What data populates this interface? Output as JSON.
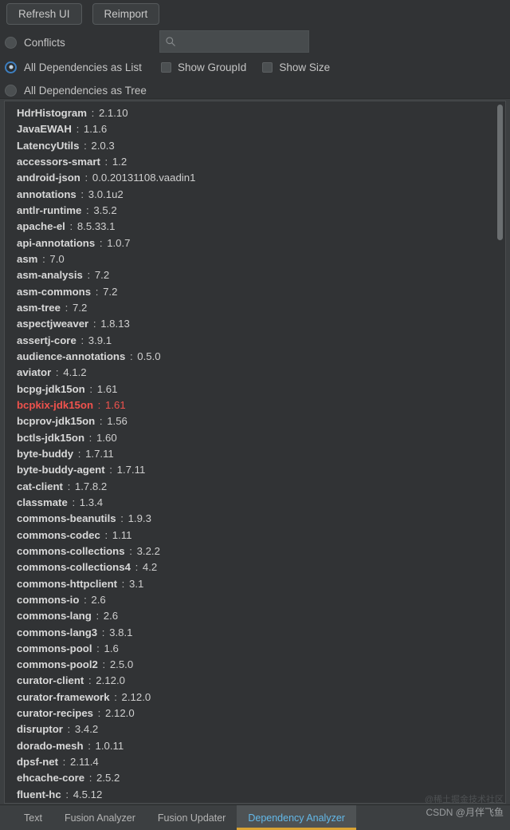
{
  "accent": {
    "gold": "#d9a334",
    "blue": "#3d7fc1",
    "tab_active_text": "#63b8e8",
    "conflict_red": "#f0524d",
    "panel_bg": "#313335",
    "window_bg": "#3c3f41"
  },
  "toolbar": {
    "buttons": [
      {
        "label": "Refresh UI",
        "icon": "refresh-icon"
      },
      {
        "label": "Reimport",
        "icon": "reimport-icon"
      }
    ],
    "view_mode_options": [
      {
        "label": "Conflicts",
        "selected": false
      },
      {
        "label": "All Dependencies as List",
        "selected": true
      },
      {
        "label": "All Dependencies as Tree",
        "selected": false
      }
    ],
    "search": {
      "icon": "search-icon",
      "value": "",
      "placeholder": ""
    },
    "checkboxes": [
      {
        "label": "Show GroupId",
        "checked": false
      },
      {
        "label": "Show Size",
        "checked": false
      }
    ]
  },
  "dependency_list": {
    "separator": ":",
    "items": [
      {
        "name": "HdrHistogram",
        "version": "2.1.10",
        "conflict": false
      },
      {
        "name": "JavaEWAH",
        "version": "1.1.6",
        "conflict": false
      },
      {
        "name": "LatencyUtils",
        "version": "2.0.3",
        "conflict": false
      },
      {
        "name": "accessors-smart",
        "version": "1.2",
        "conflict": false
      },
      {
        "name": "android-json",
        "version": "0.0.20131108.vaadin1",
        "conflict": false
      },
      {
        "name": "annotations",
        "version": "3.0.1u2",
        "conflict": false
      },
      {
        "name": "antlr-runtime",
        "version": "3.5.2",
        "conflict": false
      },
      {
        "name": "apache-el",
        "version": "8.5.33.1",
        "conflict": false
      },
      {
        "name": "api-annotations",
        "version": "1.0.7",
        "conflict": false
      },
      {
        "name": "asm",
        "version": "7.0",
        "conflict": false
      },
      {
        "name": "asm-analysis",
        "version": "7.2",
        "conflict": false
      },
      {
        "name": "asm-commons",
        "version": "7.2",
        "conflict": false
      },
      {
        "name": "asm-tree",
        "version": "7.2",
        "conflict": false
      },
      {
        "name": "aspectjweaver",
        "version": "1.8.13",
        "conflict": false
      },
      {
        "name": "assertj-core",
        "version": "3.9.1",
        "conflict": false
      },
      {
        "name": "audience-annotations",
        "version": "0.5.0",
        "conflict": false
      },
      {
        "name": "aviator",
        "version": "4.1.2",
        "conflict": false
      },
      {
        "name": "bcpg-jdk15on",
        "version": "1.61",
        "conflict": false
      },
      {
        "name": "bcpkix-jdk15on",
        "version": "1.61",
        "conflict": true
      },
      {
        "name": "bcprov-jdk15on",
        "version": "1.56",
        "conflict": false
      },
      {
        "name": "bctls-jdk15on",
        "version": "1.60",
        "conflict": false
      },
      {
        "name": "byte-buddy",
        "version": "1.7.11",
        "conflict": false
      },
      {
        "name": "byte-buddy-agent",
        "version": "1.7.11",
        "conflict": false
      },
      {
        "name": "cat-client",
        "version": "1.7.8.2",
        "conflict": false
      },
      {
        "name": "classmate",
        "version": "1.3.4",
        "conflict": false
      },
      {
        "name": "commons-beanutils",
        "version": "1.9.3",
        "conflict": false
      },
      {
        "name": "commons-codec",
        "version": "1.11",
        "conflict": false
      },
      {
        "name": "commons-collections",
        "version": "3.2.2",
        "conflict": false
      },
      {
        "name": "commons-collections4",
        "version": "4.2",
        "conflict": false
      },
      {
        "name": "commons-httpclient",
        "version": "3.1",
        "conflict": false
      },
      {
        "name": "commons-io",
        "version": "2.6",
        "conflict": false
      },
      {
        "name": "commons-lang",
        "version": "2.6",
        "conflict": false
      },
      {
        "name": "commons-lang3",
        "version": "3.8.1",
        "conflict": false
      },
      {
        "name": "commons-pool",
        "version": "1.6",
        "conflict": false
      },
      {
        "name": "commons-pool2",
        "version": "2.5.0",
        "conflict": false
      },
      {
        "name": "curator-client",
        "version": "2.12.0",
        "conflict": false
      },
      {
        "name": "curator-framework",
        "version": "2.12.0",
        "conflict": false
      },
      {
        "name": "curator-recipes",
        "version": "2.12.0",
        "conflict": false
      },
      {
        "name": "disruptor",
        "version": "3.4.2",
        "conflict": false
      },
      {
        "name": "dorado-mesh",
        "version": "1.0.11",
        "conflict": false
      },
      {
        "name": "dpsf-net",
        "version": "2.11.4",
        "conflict": false
      },
      {
        "name": "ehcache-core",
        "version": "2.5.2",
        "conflict": false
      },
      {
        "name": "fluent-hc",
        "version": "4.5.12",
        "conflict": false
      }
    ]
  },
  "tab_bar": {
    "tabs": [
      {
        "label": "Text",
        "active": false
      },
      {
        "label": "Fusion Analyzer",
        "active": false
      },
      {
        "label": "Fusion Updater",
        "active": false
      },
      {
        "label": "Dependency Analyzer",
        "active": true
      }
    ]
  },
  "watermark": {
    "line1": "@稀土掘金技术社区",
    "line2": "CSDN @月伴飞鱼"
  }
}
